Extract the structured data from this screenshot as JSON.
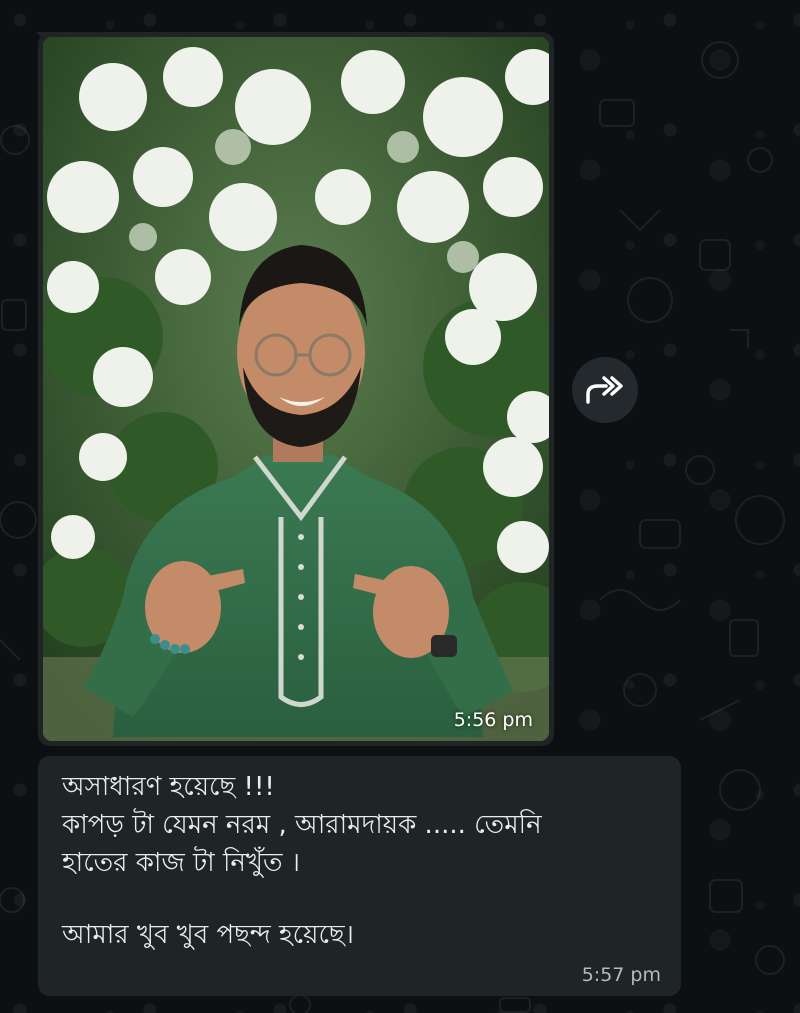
{
  "chat": {
    "photo_message": {
      "time": "5:56 pm"
    },
    "forward_icon": "forward-icon",
    "text_message": {
      "lines": [
        "অসাধারণ হয়েছে !!!",
        "কাপড় টা যেমন নরম , আরামদায়ক ..... তেমনি",
        "হাতের কাজ টা নিখুঁত ।",
        "আমার খুব খুব পছন্দ হয়েছে।"
      ],
      "time": "5:57 pm"
    }
  },
  "colors": {
    "background": "#0d1013",
    "bubble": "#1f2427",
    "text": "#e9edef",
    "timestamp": "#b4babd",
    "kurta_green": "#2f6b45"
  }
}
